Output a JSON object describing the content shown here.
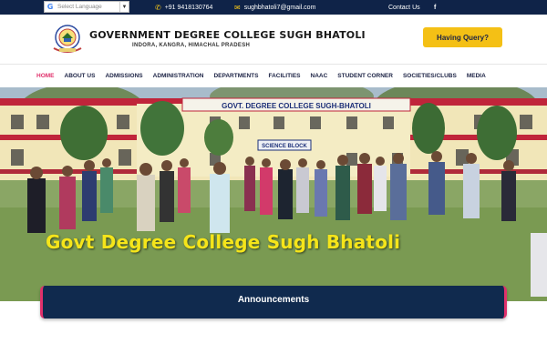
{
  "topbar": {
    "translate_label": "Select Language",
    "phone": "+91 9418130764",
    "email": "sughbhatoli7@gmail.com",
    "contact_label": "Contact Us"
  },
  "header": {
    "college_name": "GOVERNMENT DEGREE COLLEGE SUGH BHATOLI",
    "college_address": "INDORA, KANGRA, HIMACHAL PRADESH",
    "query_button": "Having Query?"
  },
  "nav": {
    "items": [
      "HOME",
      "ABOUT US",
      "ADMISSIONS",
      "ADMINISTRATION",
      "DEPARTMENTS",
      "FACILITIES",
      "NAAC",
      "STUDENT CORNER",
      "SOCIETIES/CLUBS",
      "MEDIA"
    ],
    "active": "HOME"
  },
  "hero": {
    "title": "Govt Degree College Sugh Bhatoli",
    "building_sign": "GOVT. DEGREE COLLEGE SUGH-BHATOLI",
    "block_sign": "SCIENCE BLOCK"
  },
  "announcements": {
    "title": "Announcements"
  },
  "colors": {
    "navy": "#0f2348",
    "accent_pink": "#e0306b",
    "button_yellow": "#f4c015",
    "hero_text_yellow": "#f5e51a"
  },
  "icons": [
    "google-translate-icon",
    "phone-icon",
    "email-icon",
    "facebook-icon",
    "college-emblem-icon"
  ]
}
